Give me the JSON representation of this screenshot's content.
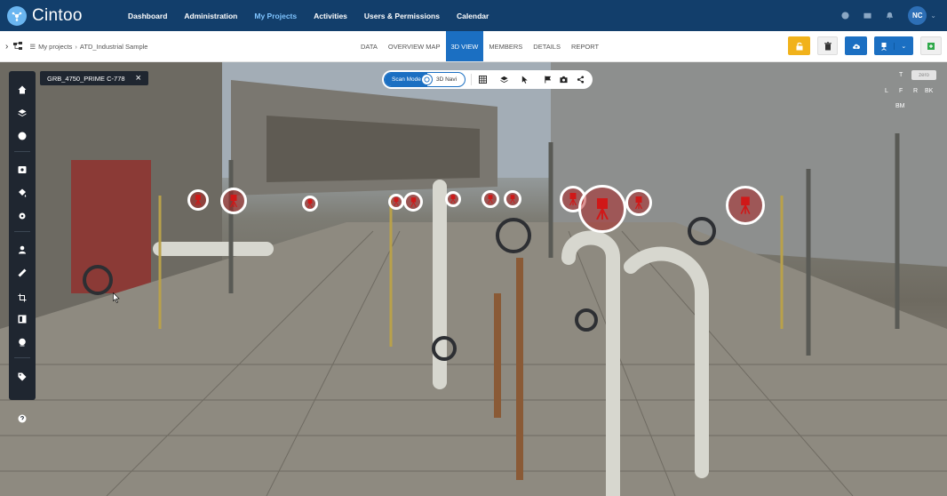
{
  "app": {
    "name": "Cintoo"
  },
  "nav": {
    "items": [
      "Dashboard",
      "Administration",
      "My Projects",
      "Activities",
      "Users & Permissions",
      "Calendar"
    ],
    "active": "My Projects"
  },
  "user": {
    "initials": "NC"
  },
  "top_icons": [
    "info-icon",
    "mail-icon",
    "bell-icon"
  ],
  "breadcrumb": {
    "root": "My projects",
    "project": "ATD_Industrial Sample"
  },
  "tabs": {
    "items": [
      "DATA",
      "OVERVIEW MAP",
      "3D VIEW",
      "MEMBERS",
      "DETAILS",
      "REPORT"
    ],
    "active": "3D VIEW"
  },
  "viewer": {
    "scan_name": "GRB_4750_PRIME C-778",
    "mode_left": "Scan Mode",
    "mode_right": "3D Navi",
    "view_cube": {
      "top": "T",
      "left": "L",
      "front": "F",
      "right": "R",
      "back": "BK",
      "bottom": "BM",
      "zero": "zero"
    }
  },
  "colors": {
    "nav_bg": "#123e6b",
    "accent": "#1b6fc2",
    "lock": "#f1b21b",
    "marker": "#d01818",
    "add": "#2fa94a"
  }
}
